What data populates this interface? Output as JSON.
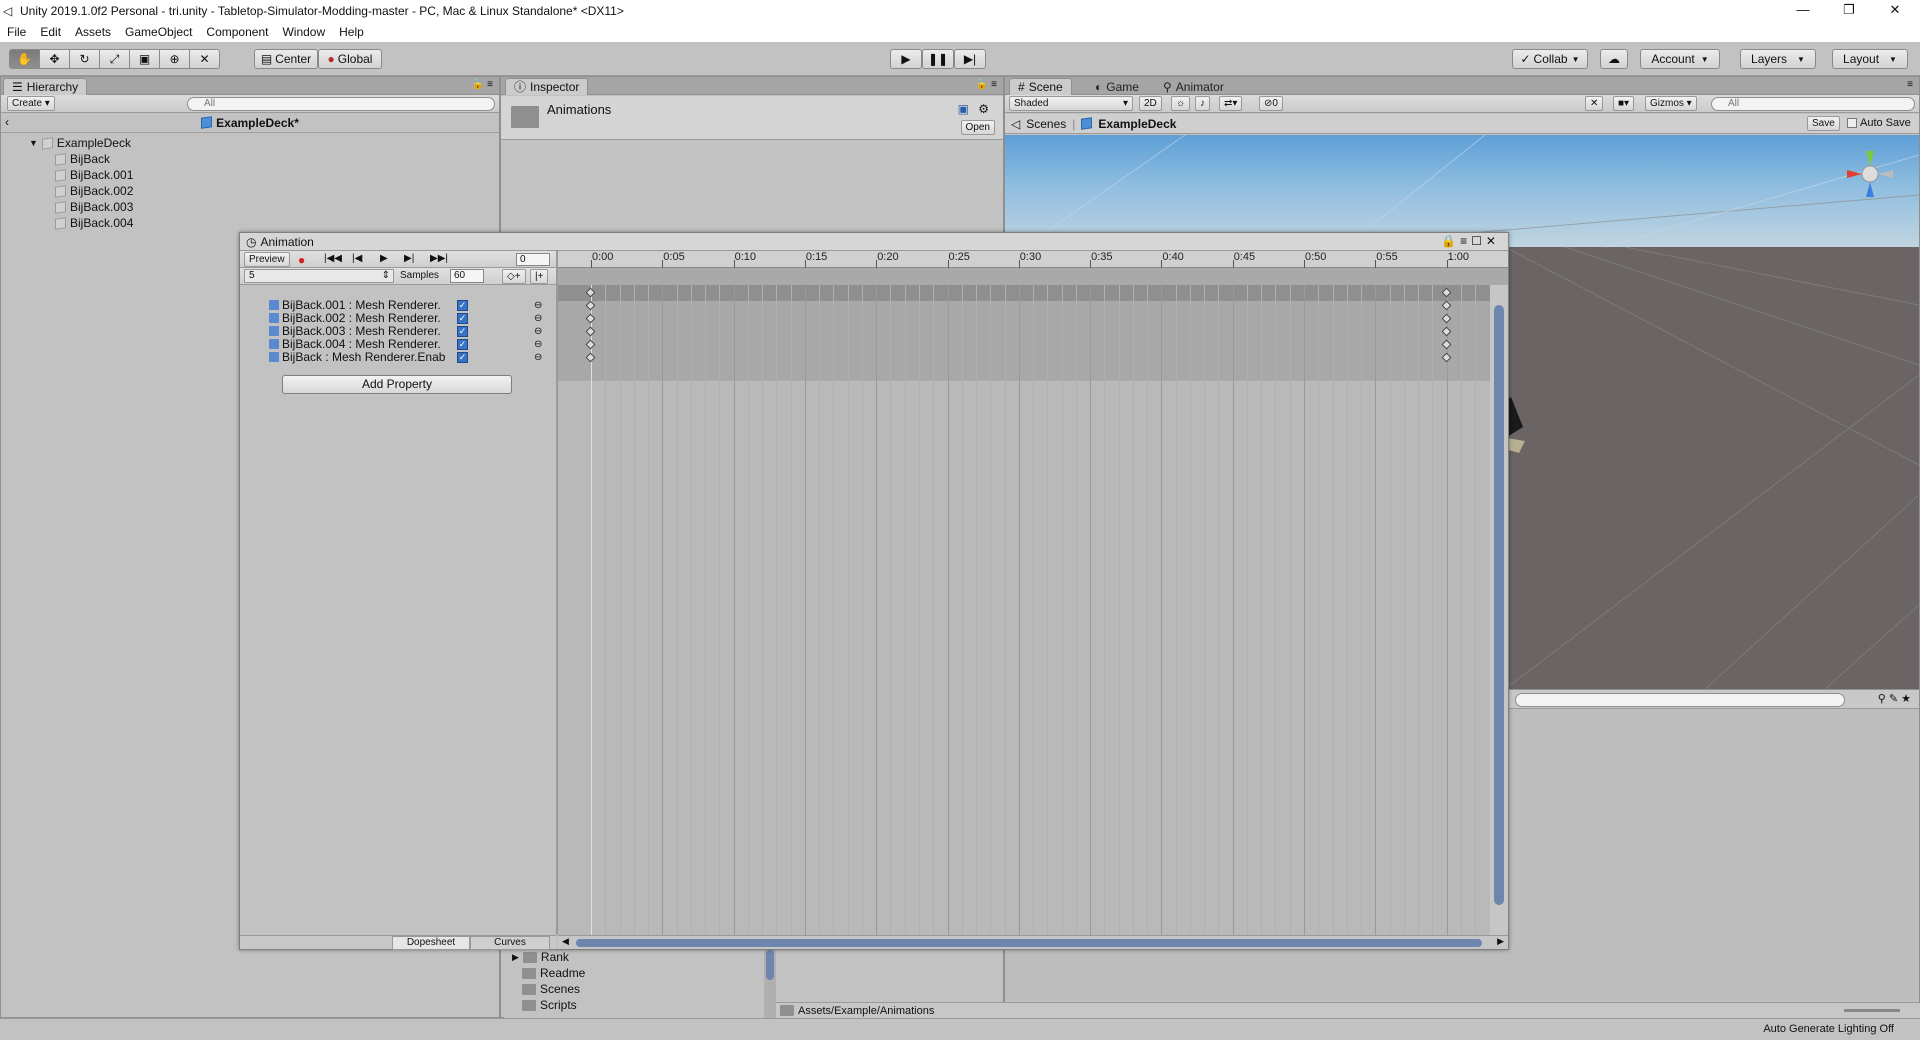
{
  "window": {
    "title": "Unity 2019.1.0f2 Personal - tri.unity - Tabletop-Simulator-Modding-master - PC, Mac & Linux Standalone* <DX11>"
  },
  "menu": [
    "File",
    "Edit",
    "Assets",
    "GameObject",
    "Component",
    "Window",
    "Help"
  ],
  "toolbar": {
    "pivot": "Center",
    "space": "Global",
    "collab": "Collab",
    "account": "Account",
    "layers": "Layers",
    "layout": "Layout"
  },
  "hierarchy": {
    "tab": "Hierarchy",
    "create": "Create",
    "search_placeholder": "All",
    "scene_name": "ExampleDeck*",
    "root": "ExampleDeck",
    "children": [
      "BijBack",
      "BijBack.001",
      "BijBack.002",
      "BijBack.003",
      "BijBack.004"
    ]
  },
  "inspector": {
    "tab": "Inspector",
    "asset_name": "Animations",
    "open_button": "Open"
  },
  "scene": {
    "tabs": [
      "Scene",
      "Game",
      "Animator"
    ],
    "shading": "Shaded",
    "mode_2d": "2D",
    "fx_count": "0",
    "gizmos": "Gizmos",
    "search_placeholder": "All",
    "breadcrumb_root": "Scenes",
    "breadcrumb_item": "ExampleDeck",
    "save": "Save",
    "auto_save": "Auto Save"
  },
  "animation": {
    "tab": "Animation",
    "preview": "Preview",
    "frame": "0",
    "clip": "5",
    "samples_label": "Samples",
    "samples": "60",
    "properties": [
      "BijBack.001 : Mesh Renderer.",
      "BijBack.002 : Mesh Renderer.",
      "BijBack.003 : Mesh Renderer.",
      "BijBack.004 : Mesh Renderer.",
      "BijBack : Mesh Renderer.Enab"
    ],
    "add_property": "Add Property",
    "dopesheet": "Dopesheet",
    "curves": "Curves",
    "ticks": [
      "0:00",
      "0:05",
      "0:10",
      "0:15",
      "0:20",
      "0:25",
      "0:30",
      "0:35",
      "0:40",
      "0:45",
      "0:50",
      "0:55",
      "1:00"
    ]
  },
  "project": {
    "folders": [
      "Rank",
      "Readme",
      "Scenes",
      "Scripts"
    ],
    "path": "Assets/Example/Animations"
  },
  "status": {
    "lighting": "Auto Generate Lighting Off"
  }
}
